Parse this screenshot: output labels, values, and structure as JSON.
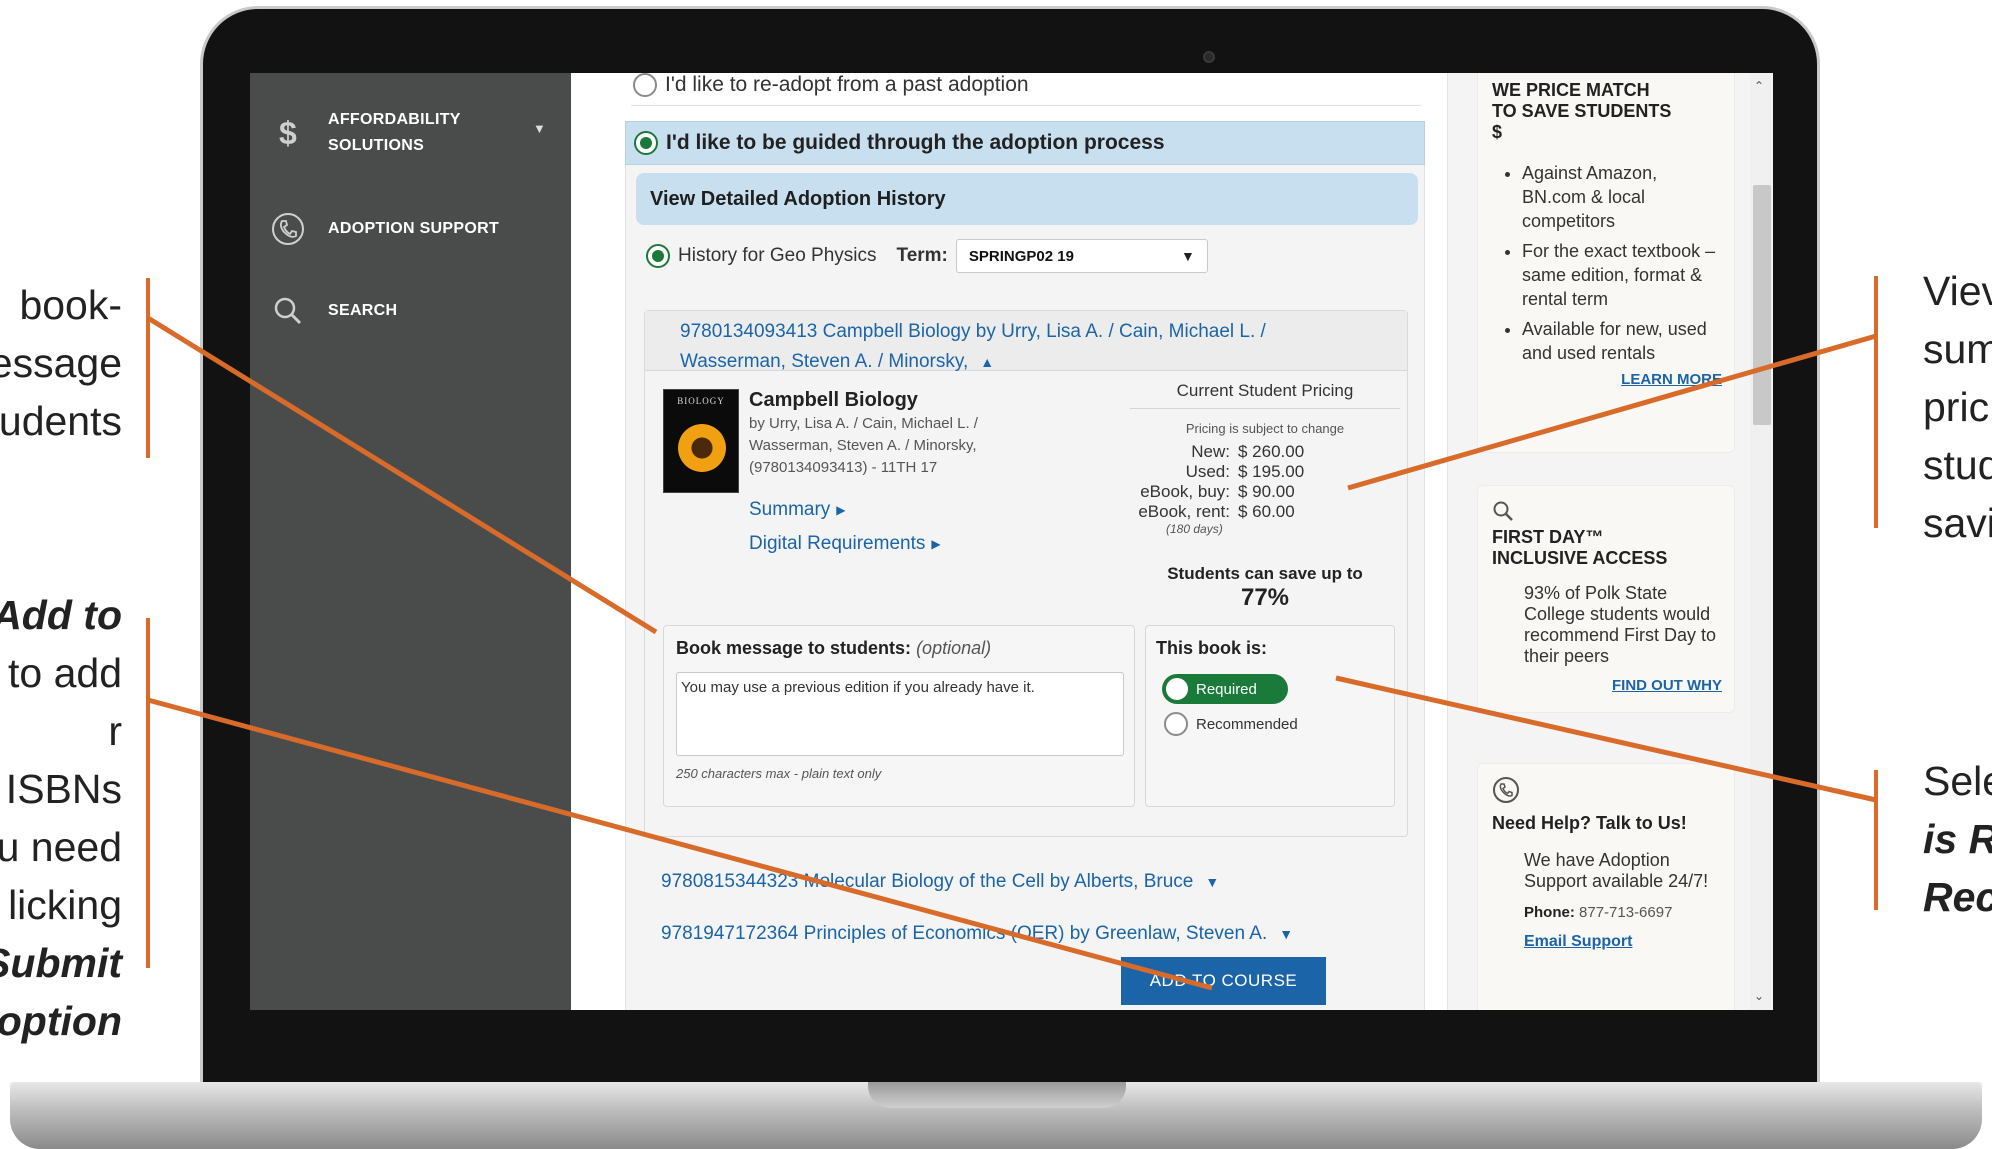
{
  "callouts": {
    "left_top": [
      "book-",
      "essage",
      "udents"
    ],
    "left_bottom": [
      "Add to",
      "to add",
      "r ISBNs",
      "u need",
      "licking",
      "Submit",
      "option"
    ],
    "right_top": [
      "Viev",
      "sum",
      "pric",
      "stud",
      "savi"
    ],
    "right_bottom": [
      "Sele",
      "is Re",
      "Rec"
    ]
  },
  "sidebar": {
    "items": [
      {
        "label_line1": "AFFORDABILITY",
        "label_line2": "SOLUTIONS",
        "icon": "dollar-icon"
      },
      {
        "label": "ADOPTION SUPPORT",
        "icon": "phone-icon"
      },
      {
        "label": "SEARCH",
        "icon": "search-icon"
      }
    ]
  },
  "main": {
    "readopt_option": "I'd like to re-adopt from a past adoption",
    "guided_option": "I'd like to be guided through the adoption process",
    "history_header": "View Detailed Adoption History",
    "history_label": "History for Geo Physics",
    "term_label": "Term:",
    "term_value": "SPRINGP02 19",
    "book": {
      "link_line1": "9780134093413 Campbell Biology by Urry, Lisa A. / Cain, Michael L. /",
      "link_line2": "Wasserman, Steven A. / Minorsky,",
      "cover_text": "BIOLOGY",
      "title": "Campbell Biology",
      "authors_line1": "by Urry, Lisa A. / Cain, Michael L. /",
      "authors_line2": "Wasserman, Steven A. / Minorsky,",
      "authors_line3": "(9780134093413) - 11TH 17",
      "summary_link": "Summary",
      "digital_link": "Digital Requirements"
    },
    "pricing": {
      "header": "Current Student Pricing",
      "note": "Pricing is subject to change",
      "rows": [
        {
          "label": "New:",
          "value": "$ 260.00"
        },
        {
          "label": "Used:",
          "value": "$ 195.00"
        },
        {
          "label": "eBook, buy:",
          "value": "$ 90.00"
        },
        {
          "label": "eBook, rent:",
          "value": "$ 60.00"
        }
      ],
      "rent_days": "(180 days)",
      "save_text": "Students can save up to",
      "save_pct": "77%"
    },
    "message": {
      "label_bold": "Book message to students:",
      "label_optional": "(optional)",
      "value": "You may use a previous edition if you already have it.",
      "hint": "250 characters max - plain text only"
    },
    "requirement": {
      "label": "This book is:",
      "required": "Required",
      "recommended": "Recommended"
    },
    "other_books": [
      "9780815344323 Molecular Biology of the Cell by Alberts, Bruce",
      "9781947172364 Principles of Economics (OER) by Greenlaw, Steven A."
    ],
    "add_button": "ADD TO COURSE"
  },
  "rail": {
    "price_match": {
      "title_line1": "WE PRICE MATCH",
      "title_line2": "TO SAVE STUDENTS",
      "title_line3": "$",
      "bullets": [
        "Against Amazon, BN.com & local competitors",
        "For the exact textbook – same edition, format & rental term",
        "Available for new, used and used rentals"
      ],
      "link": "LEARN MORE"
    },
    "first_day": {
      "title_line1": "FIRST DAY™",
      "title_line2": "INCLUSIVE ACCESS",
      "body": "93% of Polk State College students would recommend First Day to their peers",
      "link": "FIND OUT WHY"
    },
    "help": {
      "title": "Need Help? Talk to Us!",
      "body": "We have Adoption Support available 24/7!",
      "phone_label": "Phone:",
      "phone": "877-713-6697",
      "email_link": "Email Support"
    }
  },
  "colors": {
    "sidebar": "#4a4c4c",
    "accent_blue": "#1b64a8",
    "required_green": "#1a7a3a",
    "callout_orange": "#d86b2a",
    "highlight_blue": "#c8dff0"
  }
}
